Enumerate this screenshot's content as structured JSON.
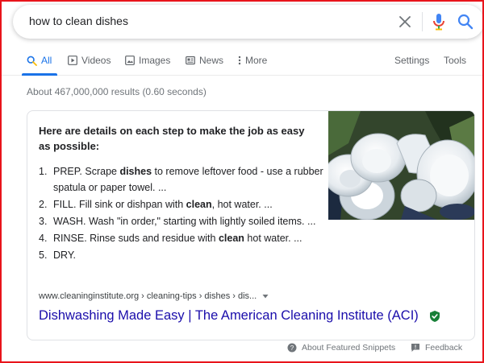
{
  "search": {
    "query": "how to clean dishes",
    "clear_icon": "close-icon",
    "mic_icon": "microphone-icon",
    "search_icon": "search-icon"
  },
  "tabs": [
    {
      "label": "All",
      "icon": "search-icon",
      "active": true
    },
    {
      "label": "Videos",
      "icon": "play-icon"
    },
    {
      "label": "Images",
      "icon": "image-icon"
    },
    {
      "label": "News",
      "icon": "newspaper-icon"
    },
    {
      "label": "More",
      "icon": "kebab-icon"
    }
  ],
  "tools": {
    "settings": "Settings",
    "tools": "Tools"
  },
  "stats": "About 467,000,000 results (0.60 seconds)",
  "snippet": {
    "heading": "Here are details on each step to make the job as easy as possible:",
    "steps": [
      {
        "num": "1.",
        "before": "PREP. Scrape ",
        "bold": "dishes",
        "after": " to remove leftover food - use a rubber spatula or paper towel. ..."
      },
      {
        "num": "2.",
        "before": "FILL. Fill sink or dishpan with ",
        "bold": "clean",
        "after": ", hot water. ..."
      },
      {
        "num": "3.",
        "before": "WASH. Wash \"in order,\" starting with lightly soiled items. ...",
        "bold": "",
        "after": ""
      },
      {
        "num": "4.",
        "before": "RINSE. Rinse suds and residue with ",
        "bold": "clean",
        "after": " hot water. ..."
      },
      {
        "num": "5.",
        "before": "DRY.",
        "bold": "",
        "after": ""
      }
    ],
    "cite": "www.cleaninginstitute.org › cleaning-tips › dishes › dis...",
    "title": "Dishwashing Made Easy | The American Cleaning Institute (ACI)"
  },
  "footer": {
    "about": "About Featured Snippets",
    "feedback": "Feedback"
  },
  "colors": {
    "link": "#1a0dab",
    "accent": "#1a73e8",
    "frame": "#e8141b",
    "verified": "#188038"
  }
}
